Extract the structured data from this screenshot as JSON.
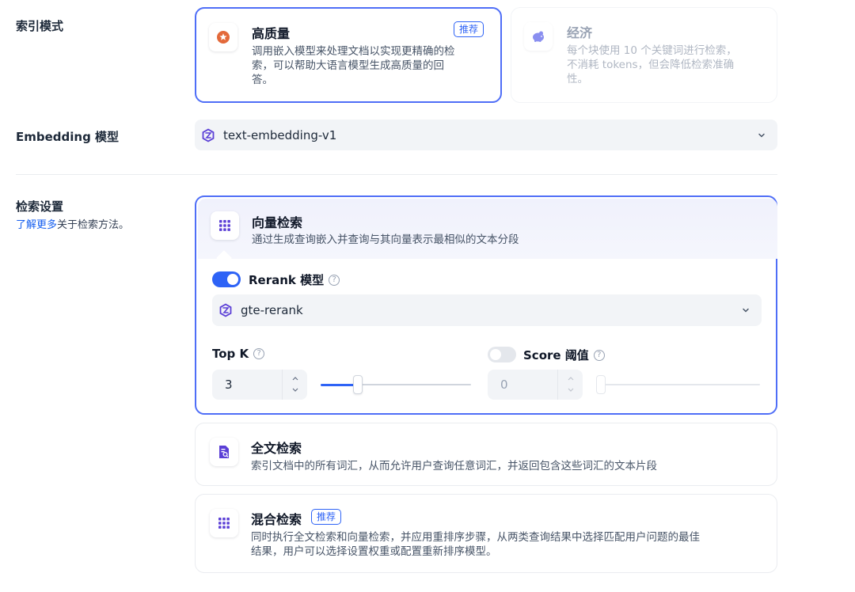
{
  "index_mode": {
    "label": "索引模式",
    "high_quality": {
      "title": "高质量",
      "badge": "推荐",
      "desc_lines": [
        "调用嵌入模型来处理文档以实现更精确的检",
        "索，可以帮助大语言模型生成高质量的回",
        "答。"
      ]
    },
    "economy": {
      "title": "经济",
      "desc_lines": [
        "每个块使用 10 个关键词进行检索，",
        "不消耗 tokens，但会降低检索准确",
        "性。"
      ]
    }
  },
  "embedding": {
    "label": "Embedding 模型",
    "value": "text-embedding-v1"
  },
  "retrieval": {
    "label": "检索设置",
    "learn_more": "了解更多",
    "learn_more_rest": "关于检索方法。",
    "vector": {
      "title": "向量检索",
      "desc": "通过生成查询嵌入并查询与其向量表示最相似的文本分段",
      "rerank_label": "Rerank 模型",
      "rerank_enabled": true,
      "rerank_value": "gte-rerank",
      "top_k_label": "Top K",
      "top_k_value": "3",
      "top_k_fraction": 0.23,
      "score_label": "Score 阈值",
      "score_enabled": false,
      "score_value": "0",
      "score_fraction": 0.0
    },
    "full_text": {
      "title": "全文检索",
      "desc": "索引文档中的所有词汇，从而允许用户查询任意词汇，并返回包含这些词汇的文本片段"
    },
    "hybrid": {
      "title": "混合检索",
      "badge": "推荐",
      "desc_lines": [
        "同时执行全文检索和向量检索，并应用重排序步骤，从两类查询结果中选择匹配用户问题的最佳",
        "结果，用户可以选择设置权重或配置重新排序模型。"
      ]
    }
  },
  "colors": {
    "accent": "#2e63f6",
    "selected_border": "#4f6ef7",
    "high_quality_icon": "#e3693a",
    "economy_icon": "#8a8ff0",
    "retrieval_icon": "#5b3fd6"
  },
  "icons": {
    "high_quality": "star-badge-icon",
    "economy": "piggy-bank-icon",
    "vector": "grid-dots-icon",
    "full_text": "document-search-icon",
    "hybrid": "grid-dots-icon",
    "model": "model-logo-icon"
  }
}
